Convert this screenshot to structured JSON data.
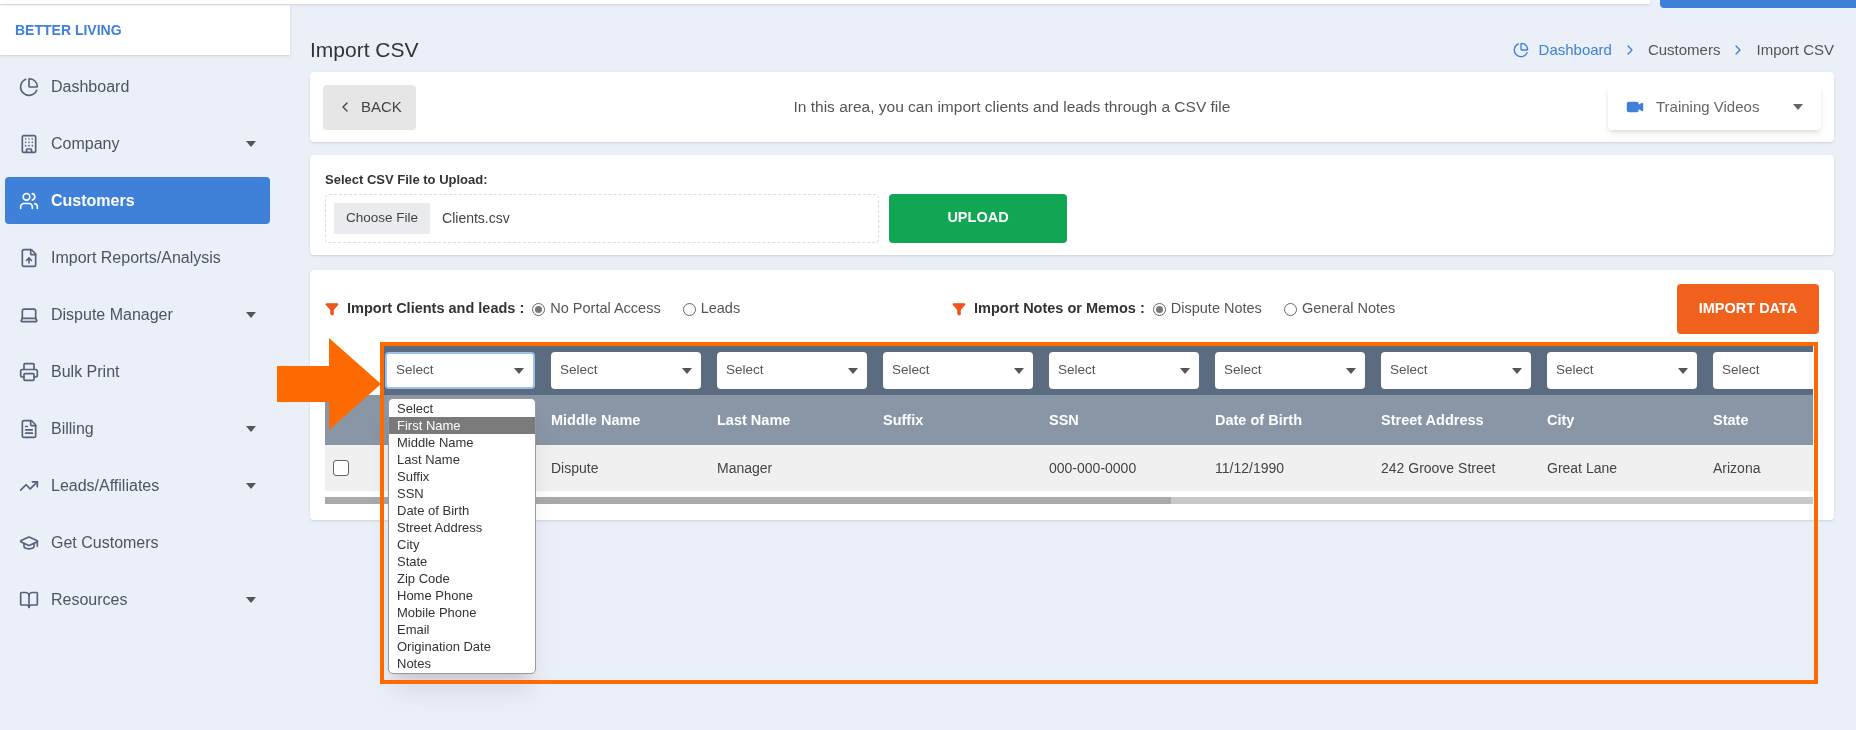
{
  "brand": "BETTER LIVING",
  "sidebar": {
    "items": [
      {
        "label": "Dashboard",
        "selected": false,
        "has_caret": false
      },
      {
        "label": "Company",
        "selected": false,
        "has_caret": true
      },
      {
        "label": "Customers",
        "selected": true,
        "has_caret": false
      },
      {
        "label": "Import Reports/Analysis",
        "selected": false,
        "has_caret": false
      },
      {
        "label": "Dispute Manager",
        "selected": false,
        "has_caret": true
      },
      {
        "label": "Bulk Print",
        "selected": false,
        "has_caret": false
      },
      {
        "label": "Billing",
        "selected": false,
        "has_caret": true
      },
      {
        "label": "Leads/Affiliates",
        "selected": false,
        "has_caret": true
      },
      {
        "label": "Get Customers",
        "selected": false,
        "has_caret": false
      },
      {
        "label": "Resources",
        "selected": false,
        "has_caret": true
      }
    ]
  },
  "page_title": "Import CSV",
  "breadcrumb": [
    "Dashboard",
    "Customers",
    "Import CSV"
  ],
  "back_button": "BACK",
  "intro": "In this area, you can import clients and leads through a CSV file",
  "training_videos": "Training Videos",
  "upload": {
    "label": "Select CSV File to Upload:",
    "choose_button": "Choose File",
    "file_name": "Clients.csv",
    "button": "UPLOAD"
  },
  "options": [
    {
      "label": "Import Clients and leads :",
      "choices": [
        {
          "label": "No Portal Access",
          "selected": true
        },
        {
          "label": "Leads",
          "selected": false
        }
      ]
    },
    {
      "label": "Import Notes or Memos :",
      "choices": [
        {
          "label": "Dispute Notes",
          "selected": true
        },
        {
          "label": "General Notes",
          "selected": false
        }
      ]
    }
  ],
  "import_button": "IMPORT DATA",
  "table": {
    "columns": [
      {
        "select": "Select",
        "open": true
      },
      {
        "select": "Select",
        "header": "Middle Name",
        "open": false
      },
      {
        "select": "Select",
        "header": "Last Name",
        "open": false
      },
      {
        "select": "Select",
        "header": "Suffix",
        "open": false
      },
      {
        "select": "Select",
        "header": "SSN",
        "open": false
      },
      {
        "select": "Select",
        "header": "Date of Birth",
        "open": false
      },
      {
        "select": "Select",
        "header": "Street Address",
        "open": false
      },
      {
        "select": "Select",
        "header": "City",
        "open": false
      },
      {
        "select": "Select",
        "header": "State",
        "open": false
      }
    ],
    "rows": [
      {
        "checked": false,
        "cells": [
          null,
          "Dispute",
          "Manager",
          null,
          "000-000-0000",
          "11/12/1990",
          "242 Groove Street",
          "Great Lane",
          "Arizona"
        ]
      }
    ]
  },
  "dropdown_options": [
    {
      "label": "Select",
      "selected": false
    },
    {
      "label": "First Name",
      "selected": true
    },
    {
      "label": "Middle Name",
      "selected": false
    },
    {
      "label": "Last Name",
      "selected": false
    },
    {
      "label": "Suffix",
      "selected": false
    },
    {
      "label": "SSN",
      "selected": false
    },
    {
      "label": "Date of Birth",
      "selected": false
    },
    {
      "label": "Street Address",
      "selected": false
    },
    {
      "label": "City",
      "selected": false
    },
    {
      "label": "State",
      "selected": false
    },
    {
      "label": "Zip Code",
      "selected": false
    },
    {
      "label": "Home Phone",
      "selected": false
    },
    {
      "label": "Mobile Phone",
      "selected": false
    },
    {
      "label": "Email",
      "selected": false
    },
    {
      "label": "Origination Date",
      "selected": false
    },
    {
      "label": "Notes",
      "selected": false
    }
  ]
}
